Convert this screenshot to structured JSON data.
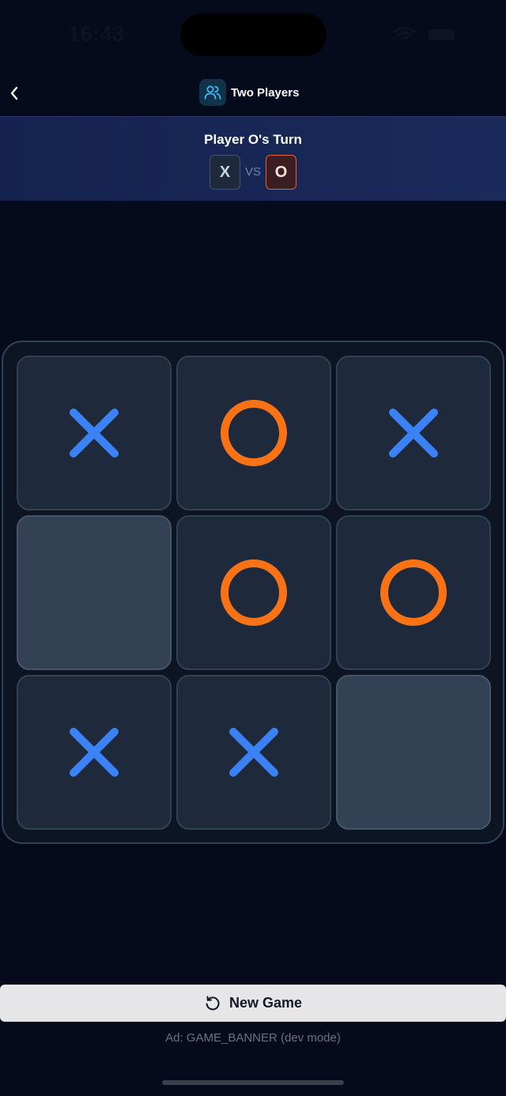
{
  "status_bar": {
    "time": "16:43"
  },
  "header": {
    "title": "Two Players",
    "back_icon": "chevron-left-icon",
    "mode_icon": "users-icon"
  },
  "turn": {
    "title": "Player O's Turn",
    "player_x": "X",
    "vs": "VS",
    "player_o": "O",
    "active_player": "O"
  },
  "board": {
    "cells": [
      "X",
      "O",
      "X",
      "",
      "O",
      "O",
      "X",
      "X",
      ""
    ]
  },
  "colors": {
    "x": "#3b82f6",
    "o": "#f97316",
    "background": "#050a1c"
  },
  "footer": {
    "new_game_label": "New Game",
    "new_game_icon": "restart-icon",
    "ad_text": "Ad: GAME_BANNER (dev mode)"
  }
}
